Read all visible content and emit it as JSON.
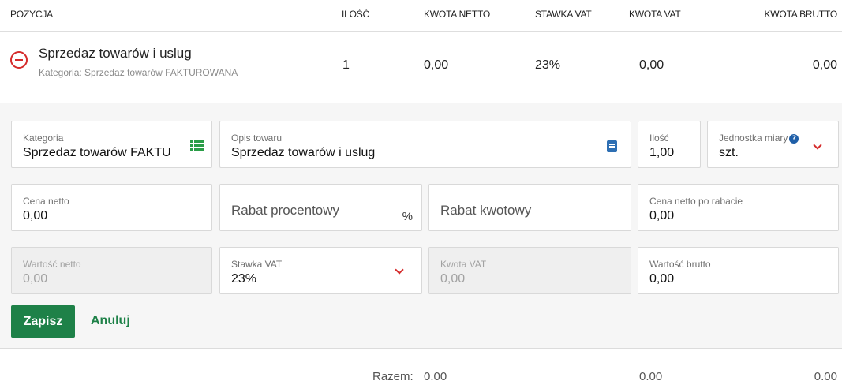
{
  "header": {
    "position": "POZYCJA",
    "quantity": "ILOŚĆ",
    "net_amount": "KWOTA NETTO",
    "vat_rate": "STAWKA VAT",
    "vat_amount": "KWOTA VAT",
    "gross_amount": "KWOTA BRUTTO"
  },
  "item": {
    "name": "Sprzedaz towarów i uslug",
    "category": "Kategoria: Sprzedaz towarów FAKTUROWANA",
    "quantity": "1",
    "net": "0,00",
    "vat_rate": "23%",
    "vat": "0,00",
    "gross": "0,00"
  },
  "form": {
    "category": {
      "label": "Kategoria",
      "value": "Sprzedaz towarów FAKTU"
    },
    "description": {
      "label": "Opis towaru",
      "value": "Sprzedaz towarów i uslug"
    },
    "quantity": {
      "label": "Ilość",
      "value": "1,00"
    },
    "unit": {
      "label": "Jednostka miary",
      "value": "szt."
    },
    "net_price": {
      "label": "Cena netto",
      "value": "0,00"
    },
    "discount_percent": {
      "placeholder": "Rabat procentowy",
      "suffix": "%"
    },
    "discount_amount": {
      "placeholder": "Rabat kwotowy"
    },
    "net_after_discount": {
      "label": "Cena netto po rabacie",
      "value": "0,00"
    },
    "net_value": {
      "label": "Wartość netto",
      "value": "0,00"
    },
    "vat_rate": {
      "label": "Stawka VAT",
      "value": "23%"
    },
    "vat_amount": {
      "label": "Kwota VAT",
      "value": "0,00"
    },
    "gross_value": {
      "label": "Wartość brutto",
      "value": "0,00"
    }
  },
  "actions": {
    "save": "Zapisz",
    "cancel": "Anuluj"
  },
  "totals": {
    "label": "Razem:",
    "net": "0.00",
    "vat": "0.00",
    "gross": "0.00"
  },
  "icons": {
    "remove": "minus-circle-icon",
    "category_picker": "list-icon",
    "description_picker": "book-icon",
    "help": "question-circle-icon",
    "dropdown": "chevron-down-icon"
  },
  "colors": {
    "primary_green": "#1e8148",
    "danger_red": "#d52b2b",
    "info_blue": "#1f5fa8",
    "panel_bg": "#f6f6f6"
  }
}
